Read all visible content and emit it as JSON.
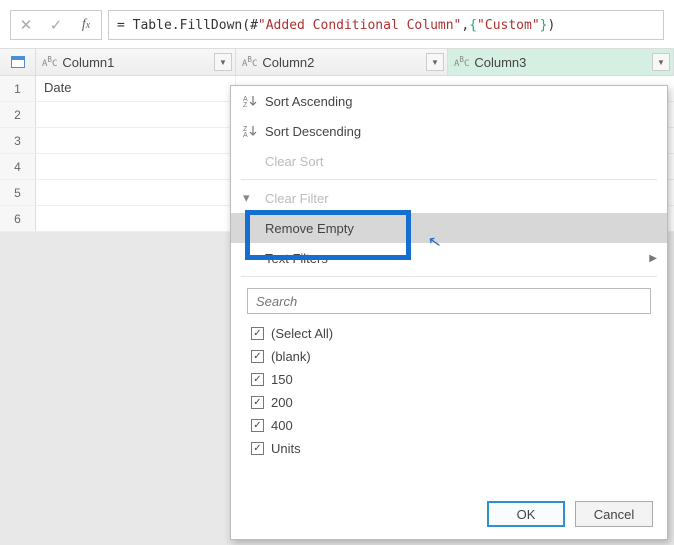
{
  "formula": {
    "prefix": "= ",
    "fn": "Table.FillDown",
    "open": "(",
    "step_hash": "#",
    "step_name": "\"Added Conditional Column\"",
    "comma": ",",
    "lbrace": "{",
    "col_literal": "\"Custom\"",
    "rbrace": "}",
    "close": ")"
  },
  "columns": [
    {
      "name": "Column1",
      "type": "ABC"
    },
    {
      "name": "Column2",
      "type": "ABC"
    },
    {
      "name": "Column3",
      "type": "ABC",
      "active": true
    }
  ],
  "rows": [
    {
      "n": "1",
      "c1": "Date"
    },
    {
      "n": "2",
      "c1": ""
    },
    {
      "n": "3",
      "c1": ""
    },
    {
      "n": "4",
      "c1": ""
    },
    {
      "n": "5",
      "c1": ""
    },
    {
      "n": "6",
      "c1": ""
    }
  ],
  "menu": {
    "sort_asc": "Sort Ascending",
    "sort_desc": "Sort Descending",
    "clear_sort": "Clear Sort",
    "clear_filter": "Clear Filter",
    "remove_empty": "Remove Empty",
    "text_filters": "Text Filters",
    "search_placeholder": "Search",
    "options": [
      {
        "label": "(Select All)",
        "checked": true
      },
      {
        "label": "(blank)",
        "checked": true
      },
      {
        "label": "150",
        "checked": true
      },
      {
        "label": "200",
        "checked": true
      },
      {
        "label": "400",
        "checked": true
      },
      {
        "label": "Units",
        "checked": true
      }
    ],
    "ok": "OK",
    "cancel": "Cancel"
  }
}
